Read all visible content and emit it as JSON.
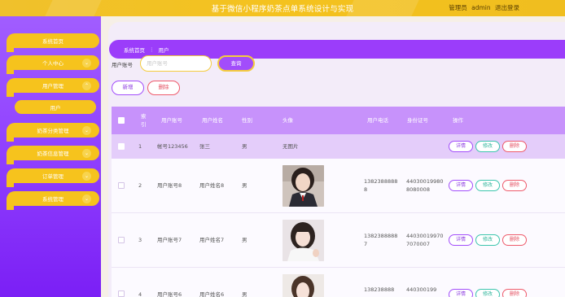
{
  "header": {
    "title": "基于微信小程序奶茶点单系统设计与实现",
    "role": "管理员",
    "username": "admin",
    "logout": "退出登录"
  },
  "sidebar": {
    "items": [
      {
        "label": "系统首页",
        "expandable": false
      },
      {
        "label": "个人中心",
        "expandable": true,
        "chevron": "down"
      },
      {
        "label": "用户管理",
        "expandable": true,
        "chevron": "up",
        "children": [
          "用户"
        ]
      },
      {
        "label": "奶茶分类管理",
        "expandable": true,
        "chevron": "down"
      },
      {
        "label": "奶茶信息管理",
        "expandable": true,
        "chevron": "down"
      },
      {
        "label": "订单管理",
        "expandable": true,
        "chevron": "down"
      },
      {
        "label": "系统管理",
        "expandable": true,
        "chevron": "down"
      }
    ]
  },
  "breadcrumb": {
    "home": "系统首页",
    "separator": "⋮",
    "current": "用户"
  },
  "search": {
    "label": "用户账号",
    "placeholder": "用户账号",
    "button": "查询"
  },
  "actions": {
    "add": "新增",
    "delete": "删除"
  },
  "table": {
    "headers": [
      "索引",
      "用户账号",
      "用户姓名",
      "性别",
      "头像",
      "用户电话",
      "身份证号",
      "操作"
    ],
    "rows": [
      {
        "index": "1",
        "account": "帐号123456",
        "name": "张三",
        "gender": "男",
        "avatar": "无图片",
        "phone": "",
        "idcard": ""
      },
      {
        "index": "2",
        "account": "用户账号8",
        "name": "用户姓名8",
        "gender": "男",
        "avatar": "photo",
        "phone": "13823888888",
        "idcard": "440300199808080008"
      },
      {
        "index": "3",
        "account": "用户账号7",
        "name": "用户姓名7",
        "gender": "男",
        "avatar": "photo",
        "phone": "13823888887",
        "idcard": "440300199707070007"
      },
      {
        "index": "4",
        "account": "用户账号6",
        "name": "用户姓名6",
        "gender": "男",
        "avatar": "photo",
        "phone": "138238888",
        "idcard": "440300199"
      }
    ],
    "ops": {
      "detail": "详情",
      "edit": "修改",
      "remove": "删除"
    }
  },
  "colors": {
    "accent_purple": "#9b3dfa",
    "accent_yellow": "#f6c31d",
    "detail": "#a24dfb",
    "edit": "#3cc5ad",
    "remove": "#ee5a6b"
  }
}
